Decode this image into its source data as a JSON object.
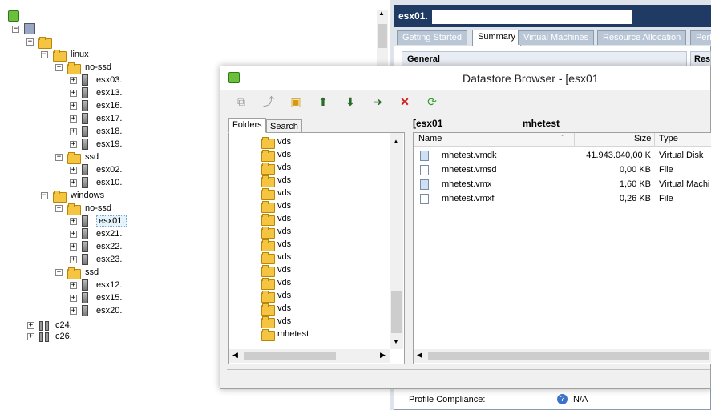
{
  "inventory": {
    "nodes": [
      {
        "label": "linux",
        "kind": "folder",
        "toggle": "minus"
      },
      {
        "label": "no-ssd",
        "kind": "folder",
        "toggle": "minus"
      },
      {
        "label": "esx03.",
        "kind": "host",
        "toggle": "plus"
      },
      {
        "label": "esx13.",
        "kind": "host",
        "toggle": "plus"
      },
      {
        "label": "esx16.",
        "kind": "host",
        "toggle": "plus"
      },
      {
        "label": "esx17.",
        "kind": "host",
        "toggle": "plus"
      },
      {
        "label": "esx18.",
        "kind": "host",
        "toggle": "plus"
      },
      {
        "label": "esx19.",
        "kind": "host",
        "toggle": "plus"
      },
      {
        "label": "ssd",
        "kind": "folder",
        "toggle": "minus"
      },
      {
        "label": "esx02.",
        "kind": "host",
        "toggle": "plus"
      },
      {
        "label": "esx10.",
        "kind": "host",
        "toggle": "plus"
      },
      {
        "label": "windows",
        "kind": "folder",
        "toggle": "minus"
      },
      {
        "label": "no-ssd",
        "kind": "folder",
        "toggle": "minus"
      },
      {
        "label": "esx01.",
        "kind": "host",
        "toggle": "plus",
        "selected": true
      },
      {
        "label": "esx21.",
        "kind": "host",
        "toggle": "plus"
      },
      {
        "label": "esx22.",
        "kind": "host",
        "toggle": "plus"
      },
      {
        "label": "esx23.",
        "kind": "host",
        "toggle": "plus"
      },
      {
        "label": "ssd",
        "kind": "folder",
        "toggle": "minus"
      },
      {
        "label": "esx12.",
        "kind": "host",
        "toggle": "plus"
      },
      {
        "label": "esx15.",
        "kind": "host",
        "toggle": "plus"
      },
      {
        "label": "esx20.",
        "kind": "host",
        "toggle": "plus"
      },
      {
        "label": "c24.",
        "kind": "cluster",
        "toggle": "plus"
      },
      {
        "label": "c26.",
        "kind": "cluster",
        "toggle": "plus"
      }
    ]
  },
  "host_panel": {
    "title": "esx01.",
    "tabs": [
      "Getting Started",
      "Summary",
      "Virtual Machines",
      "Resource Allocation",
      "Perf"
    ],
    "active_tab": "Summary",
    "general_heading": "General",
    "resources_heading": "Res",
    "profile_label": "Profile Compliance:",
    "profile_value": "N/A"
  },
  "datastore_browser": {
    "title": "Datastore Browser - [esx01",
    "tabs": {
      "folders": "Folders",
      "search": "Search"
    },
    "folders": [
      "vds",
      "vds",
      "vds",
      "vds",
      "vds",
      "vds",
      "vds",
      "vds",
      "vds",
      "vds",
      "vds",
      "vds",
      "vds",
      "vds",
      "vds",
      "mhetest"
    ],
    "path_prefix": "[esx01",
    "path_folder": "mhetest",
    "columns": {
      "name": "Name",
      "size": "Size",
      "type": "Type"
    },
    "files": [
      {
        "name": "mhetest.vmdk",
        "size": "41.943.040,00 K",
        "type": "Virtual Disk",
        "icon": "virtual-disk-icon"
      },
      {
        "name": "mhetest.vmsd",
        "size": "0,00 KB",
        "type": "File",
        "icon": "file-icon"
      },
      {
        "name": "mhetest.vmx",
        "size": "1,60 KB",
        "type": "Virtual Machi",
        "icon": "vm-config-icon"
      },
      {
        "name": "mhetest.vmxf",
        "size": "0,26 KB",
        "type": "File",
        "icon": "file-icon"
      }
    ]
  },
  "colors": {
    "accent": "#316ac5",
    "tab_bg": "#b9c6d6",
    "title_bar": "#1f3a63"
  }
}
